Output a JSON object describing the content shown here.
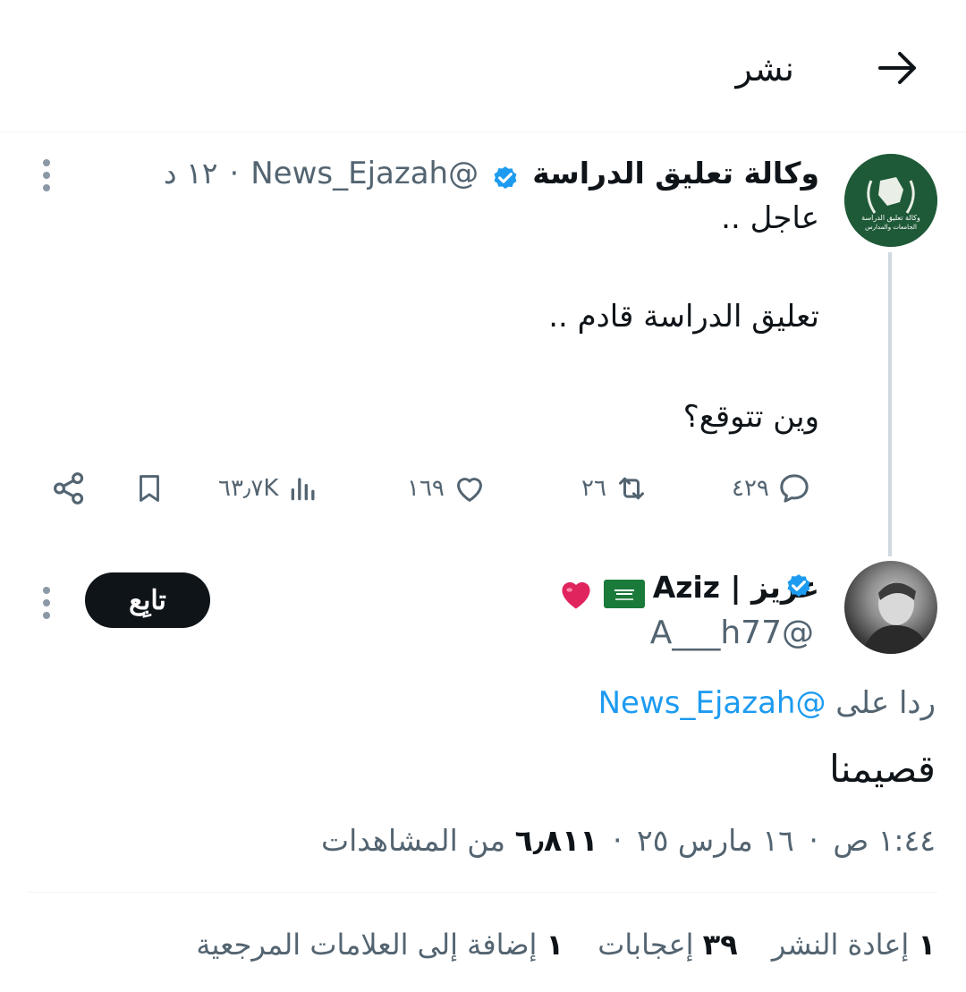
{
  "header": {
    "title": "نشر",
    "back_icon": "arrow-right-icon"
  },
  "parent_tweet": {
    "author_name": "وكالة تعليق الدراسة",
    "handle": "@News_Ejazah",
    "separator": "·",
    "time_ago": "١٢ د",
    "avatar_text_line1": "وكالة تعليق الدراسة",
    "avatar_text_line2": "الجامعات والمدارس",
    "lines": [
      "عاجل ..",
      "تعليق الدراسة قادم ..",
      "وين تتوقع؟"
    ],
    "actions": {
      "reply_count": "٤٢٩",
      "repost_count": "٢٦",
      "like_count": "١٦٩",
      "views_count": "٦٣٫٧K"
    }
  },
  "reply_tweet": {
    "author_name": "عزيز | Aziz",
    "handle": "@A___h77",
    "follow_label": "تابِع",
    "reply_to_prefix": "ردا على",
    "reply_to_handle": "@News_Ejazah",
    "text": "قصيمنا",
    "time": "١:٤٤ ص",
    "date": "١٦ مارس ٢٥",
    "views_value": "٦٫٨١١",
    "views_label": "من المشاهدات",
    "dot": "·"
  },
  "stats": {
    "reposts_value": "١",
    "reposts_label": "إعادة النشر",
    "likes_value": "٣٩",
    "likes_label": "إعجابات",
    "bookmarks_value": "١",
    "bookmarks_label": "إضافة إلى العلامات المرجعية"
  },
  "colors": {
    "accent": "#1d9bf0",
    "text": "#0f1419",
    "secondary": "#536471",
    "heart": "#e0245e"
  }
}
